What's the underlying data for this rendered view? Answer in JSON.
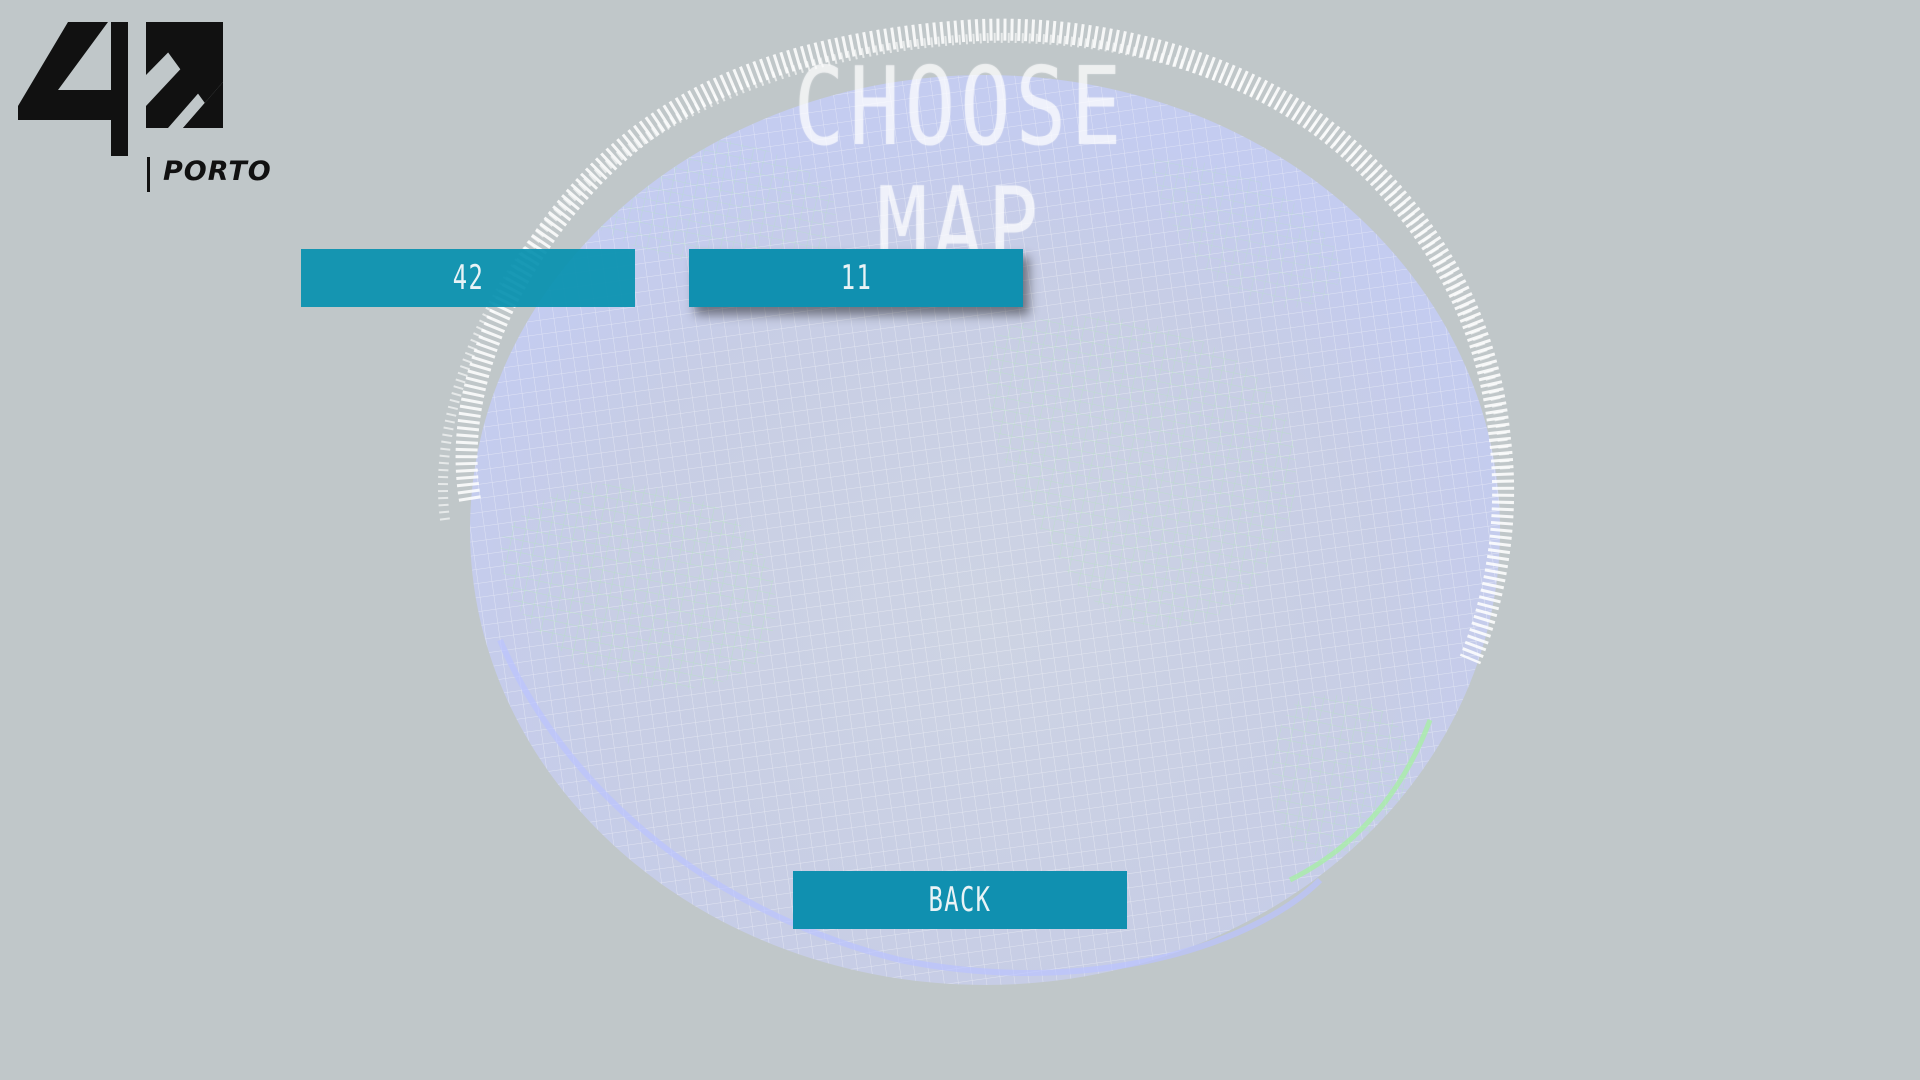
{
  "screen": {
    "title": "CHOOSE MAP"
  },
  "logo": {
    "mark": "42",
    "label": "PORTO"
  },
  "map_options": [
    {
      "label": "42"
    },
    {
      "label": "11"
    }
  ],
  "back_button": {
    "label": "BACK"
  },
  "colors": {
    "background": "#c0c7c9",
    "button": "#1090b0",
    "button_text": "#e9f3f6",
    "globe_wire": "#ffffff",
    "globe_land": "#b6f0b6",
    "globe_ocean": "#c9d2ff"
  }
}
